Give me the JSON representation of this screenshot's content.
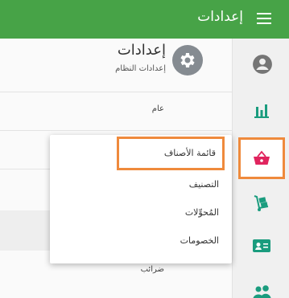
{
  "appbar": {
    "title": "إعدادات"
  },
  "header": {
    "title": "إعدادات",
    "subtitle": "إعدادات النظام"
  },
  "settings_rows": [
    "عام",
    "ضرائب"
  ],
  "rail": {
    "items": [
      {
        "icon": "account-circle-icon"
      },
      {
        "icon": "bar-chart-icon"
      },
      {
        "icon": "shopping-basket-icon",
        "active": true,
        "accent": "#e0245e"
      },
      {
        "icon": "hand-truck-icon"
      },
      {
        "icon": "id-card-icon"
      },
      {
        "icon": "people-icon"
      }
    ]
  },
  "popup": {
    "items": [
      {
        "label": "قائمة الأصناف",
        "highlighted": true
      },
      {
        "label": "التصنيف"
      },
      {
        "label": "المُحوِّلات"
      },
      {
        "label": "الخصومات"
      }
    ]
  },
  "colors": {
    "appbar": "#47a347",
    "rail_icons": "#1a9c7e",
    "highlight": "#ef8a3c",
    "active_icon": "#e0245e"
  }
}
